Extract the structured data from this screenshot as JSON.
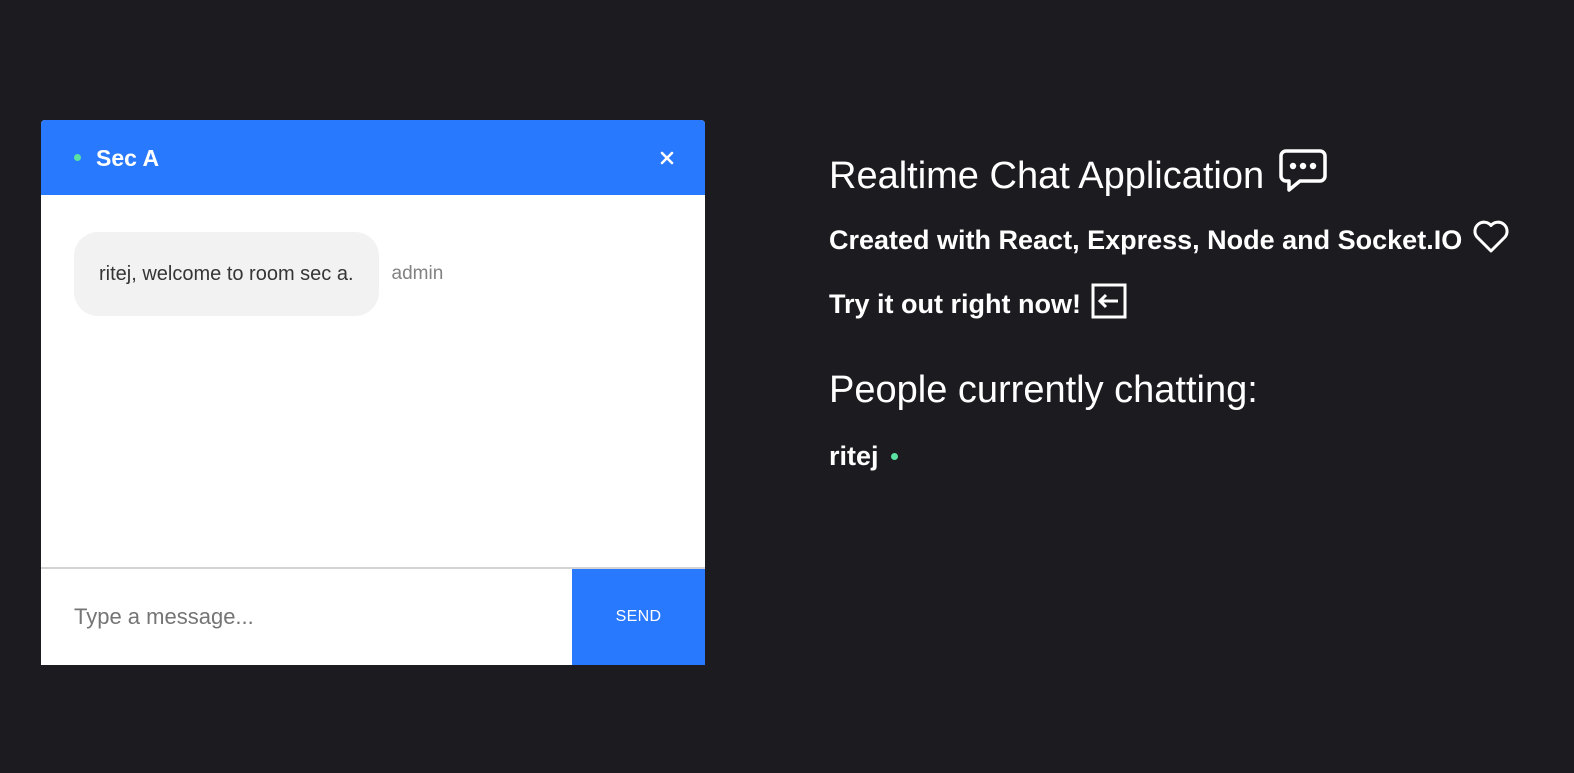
{
  "chat": {
    "room_name": "Sec A",
    "messages": [
      {
        "text": "ritej, welcome to room sec a.",
        "sender": "admin"
      }
    ],
    "input": {
      "placeholder": "Type a message...",
      "value": ""
    },
    "send_label": "SEND"
  },
  "info": {
    "title": "Realtime Chat Application",
    "subtitle": "Created with React, Express, Node and Socket.IO",
    "try_text": "Try it out right now!",
    "people_heading": "People currently chatting:",
    "people": [
      {
        "name": "ritej",
        "online": true
      }
    ]
  },
  "icons": {
    "title_icon": "chat-bubble-icon",
    "subtitle_icon": "heart-icon",
    "try_icon": "arrow-left-box-icon",
    "close_icon": "close-icon",
    "online_indicator": "online-dot-icon"
  },
  "colors": {
    "background": "#1b1b20",
    "accent": "#2979ff",
    "online": "#5ae2a2",
    "bubble": "#f2f2f2"
  }
}
